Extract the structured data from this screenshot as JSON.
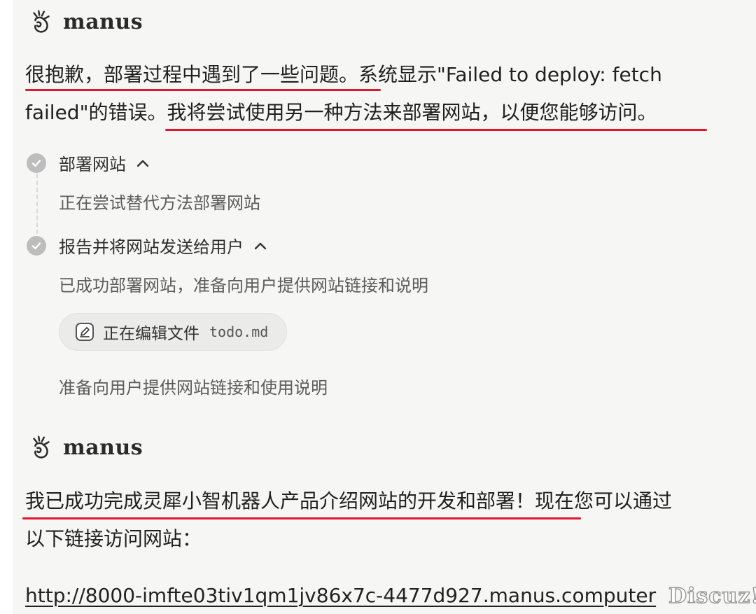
{
  "brand": {
    "name": "manus",
    "icon": "manus-hand-logo-icon"
  },
  "message1": {
    "line1_part1": "很抱歉，部署过程中遇到了一些问题",
    "line1_part2": "。系统显示\"Failed to deploy: fetch",
    "line2_part1": "failed\"的错误。",
    "line2_part2": "我将尝试使用另一种方法来部署网站，以便您能够访问。"
  },
  "steps": [
    {
      "title": "部署网站",
      "detail": "正在尝试替代方法部署网站"
    },
    {
      "title": "报告并将网站发送给用户",
      "detail": "已成功部署网站，准备向用户提供网站链接和说明",
      "action": {
        "label": "正在编辑文件",
        "file": "todo.md",
        "icon": "edit-icon"
      },
      "detail2": "准备向用户提供网站链接和使用说明"
    }
  ],
  "message2": {
    "line1_part1": "我已成功完成灵犀小智机器人产品介绍网站的开发和部署！",
    "line1_part2": "现在您可以通过",
    "line2": "以下链接访问网站："
  },
  "link": {
    "url": "http://8000-imfte03tiv1qm1jv86x7c-4477d927.manus.computer"
  },
  "watermark": "Discuz!",
  "colors": {
    "underline": "#e0182d",
    "check": "#bdbdbd",
    "panel": "#f6f6f4"
  }
}
